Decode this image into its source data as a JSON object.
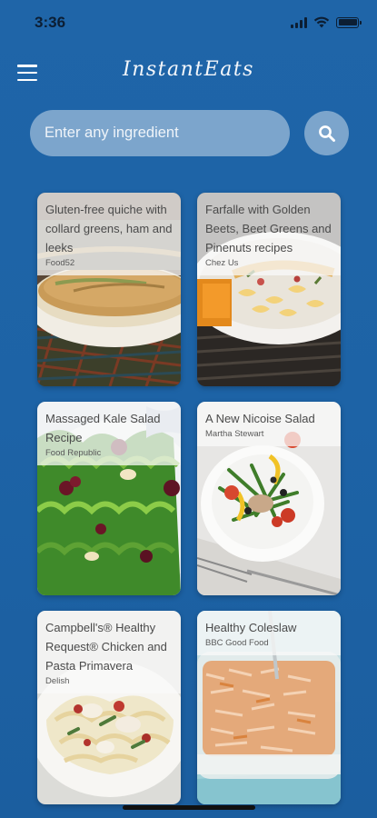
{
  "status_bar": {
    "time": "3:36"
  },
  "app": {
    "title": "InstantEats"
  },
  "search": {
    "placeholder": "Enter any ingredient",
    "value": ""
  },
  "recipes": [
    {
      "title": "Gluten-free quiche with collard greens, ham and leeks",
      "source": "Food52",
      "image": "quiche-photo"
    },
    {
      "title": "Farfalle with Golden Beets, Beet Greens and Pinenuts recipes",
      "source": "Chez Us",
      "image": "farfalle-pasta-photo"
    },
    {
      "title": "Massaged Kale Salad Recipe",
      "source": "Food Republic",
      "image": "kale-salad-photo"
    },
    {
      "title": "A New Nicoise Salad",
      "source": "Martha Stewart",
      "image": "nicoise-salad-photo"
    },
    {
      "title": "Campbell's® Healthy Request® Chicken and Pasta Primavera",
      "source": "Delish",
      "image": "chicken-pasta-photo"
    },
    {
      "title": "Healthy Coleslaw",
      "source": "BBC Good Food",
      "image": "coleslaw-photo"
    }
  ]
}
